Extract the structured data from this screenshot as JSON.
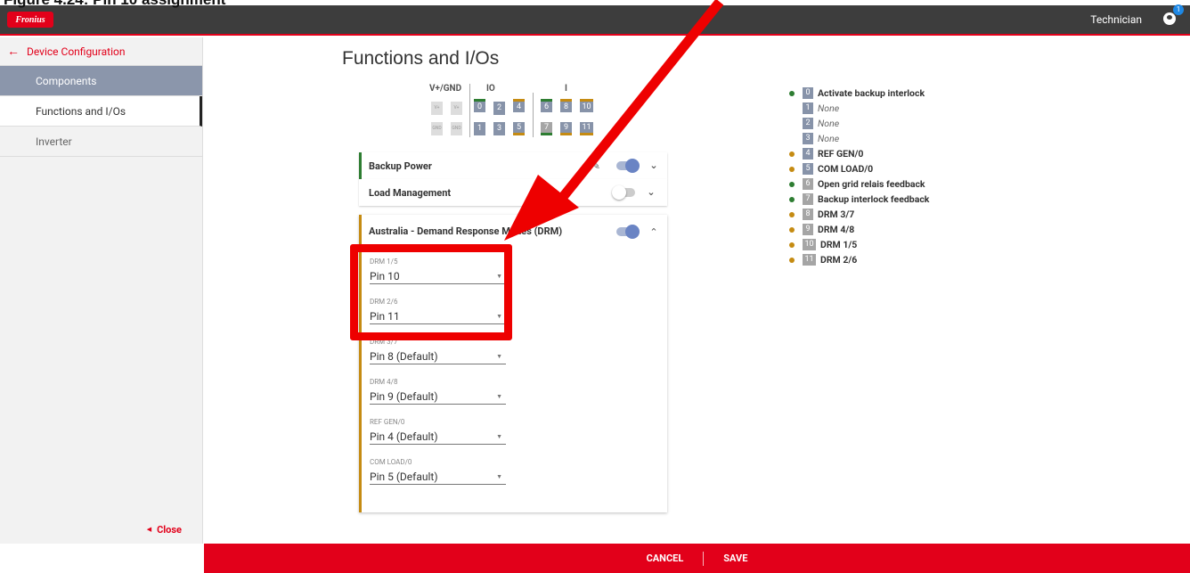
{
  "caption": "Figure 4.24: Pin 10 assignment",
  "topbar": {
    "logo": "Fronius",
    "role": "Technician",
    "notification_count": "1"
  },
  "sidebar": {
    "back_label": "Device Configuration",
    "items": [
      {
        "label": "Components"
      },
      {
        "label": "Functions and I/Os"
      },
      {
        "label": "Inverter"
      }
    ],
    "close_label": "Close"
  },
  "page_title": "Functions and I/Os",
  "pin_map": {
    "groups": [
      "V+/GND",
      "IO",
      "I"
    ],
    "vplus": [
      "V+",
      "V+"
    ],
    "gnd": [
      "GND",
      "GND"
    ],
    "top_pins": [
      "0",
      "2",
      "4",
      "6",
      "8",
      "10"
    ],
    "bottom_pins": [
      "1",
      "3",
      "5",
      "7",
      "9",
      "11"
    ]
  },
  "panels": {
    "backup_power": "Backup Power",
    "load_management": "Load Management",
    "drm": "Australia - Demand Response Modes (DRM)"
  },
  "drm_fields": [
    {
      "label": "DRM 1/5",
      "value": "Pin 10"
    },
    {
      "label": "DRM 2/6",
      "value": "Pin 11"
    },
    {
      "label": "DRM 3/7",
      "value": "Pin 8 (Default)"
    },
    {
      "label": "DRM 4/8",
      "value": "Pin 9 (Default)"
    },
    {
      "label": "REF GEN/0",
      "value": "Pin 4 (Default)"
    },
    {
      "label": "COM LOAD/0",
      "value": "Pin 5 (Default)"
    }
  ],
  "legend": [
    {
      "pin": "0",
      "text": "Activate backup interlock"
    },
    {
      "pin": "1",
      "text": "None"
    },
    {
      "pin": "2",
      "text": "None"
    },
    {
      "pin": "3",
      "text": "None"
    },
    {
      "pin": "4",
      "text": "REF GEN/0"
    },
    {
      "pin": "5",
      "text": "COM LOAD/0"
    },
    {
      "pin": "6",
      "text": "Open grid relais feedback"
    },
    {
      "pin": "7",
      "text": "Backup interlock feedback"
    },
    {
      "pin": "8",
      "text": "DRM 3/7"
    },
    {
      "pin": "9",
      "text": "DRM 4/8"
    },
    {
      "pin": "10",
      "text": "DRM 1/5"
    },
    {
      "pin": "11",
      "text": "DRM 2/6"
    }
  ],
  "footer": {
    "cancel": "CANCEL",
    "save": "SAVE"
  },
  "colors": {
    "brand_red": "#e2001a",
    "active_blue": "#8b96ab",
    "green": "#2e7d32",
    "orange": "#c58b12"
  }
}
